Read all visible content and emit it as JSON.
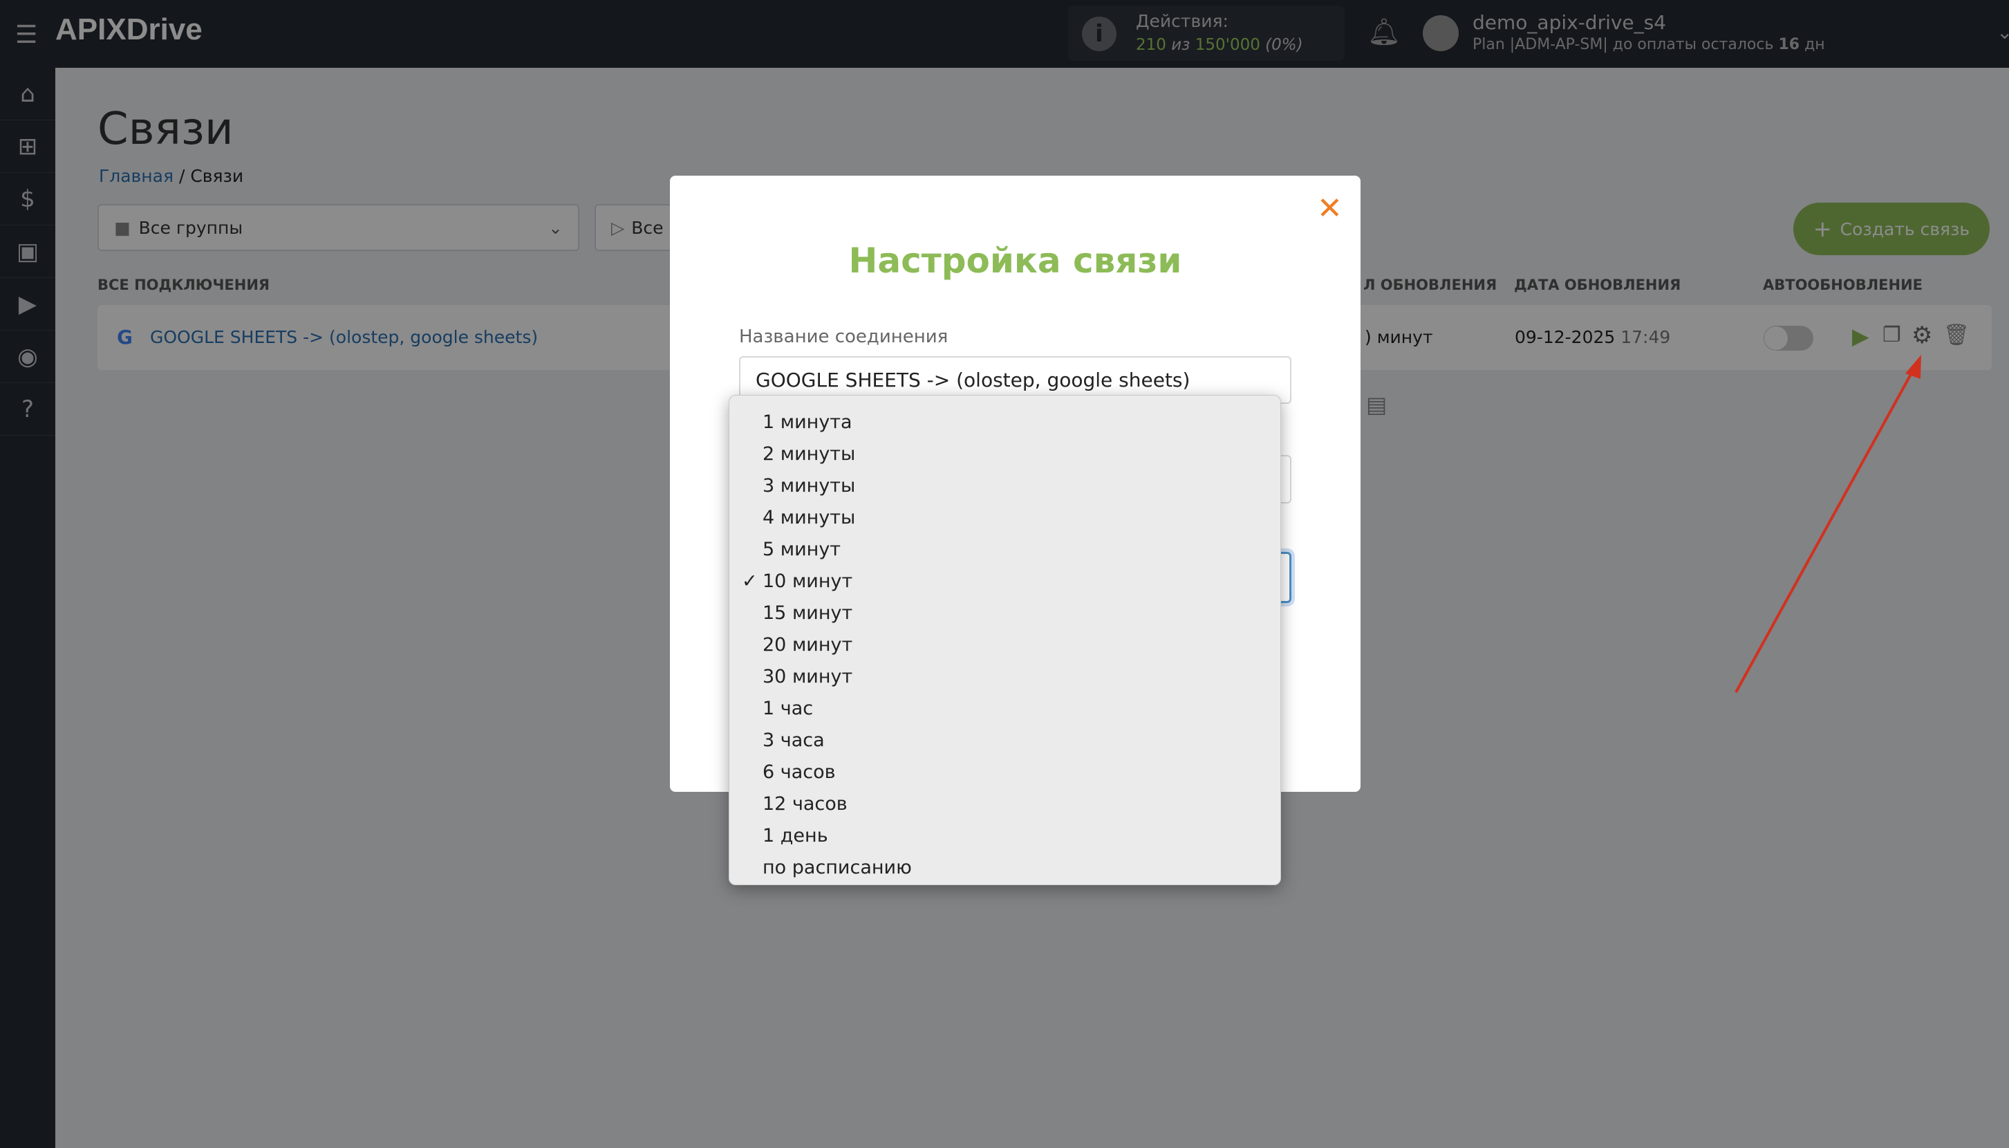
{
  "header": {
    "logo": "APIXDrive",
    "actions_label": "Действия:",
    "actions_used": "210",
    "actions_sep": "из",
    "actions_total": "150'000",
    "actions_pct": "(0%)",
    "username": "demo_apix-drive_s4",
    "plan_prefix": "Plan |ADM-AP-SM| до оплаты осталось",
    "plan_days": "16",
    "plan_suffix": "дн"
  },
  "page": {
    "title": "Связи",
    "breadcrumb_home": "Главная",
    "breadcrumb_sep": "/",
    "breadcrumb_current": "Связи",
    "group_select": "Все группы",
    "status_select": "Все",
    "create_button": "Создать связь"
  },
  "table": {
    "col_all": "ВСЕ ПОДКЛЮЧЕНИЯ",
    "col_interval": "Л ОБНОВЛЕНИЯ",
    "col_date": "ДАТА ОБНОВЛЕНИЯ",
    "col_auto": "АВТООБНОВЛЕНИЕ",
    "row": {
      "name": "GOOGLE SHEETS -> (olostep, google sheets)",
      "interval": ") минут",
      "date": "09-12-2025",
      "time": "17:49",
      "autoupdate": false
    }
  },
  "modal": {
    "title": "Настройка связи",
    "name_label": "Название соединения",
    "name_value": "GOOGLE SHEETS -> (olostep, google sheets)"
  },
  "dropdown": {
    "selected": "10 минут",
    "options": [
      "1 минута",
      "2 минуты",
      "3 минуты",
      "4 минуты",
      "5 минут",
      "10 минут",
      "15 минут",
      "20 минут",
      "30 минут",
      "1 час",
      "3 часа",
      "6 часов",
      "12 часов",
      "1 день",
      "по расписанию"
    ]
  },
  "colors": {
    "accent": "#8dbb57",
    "close": "#f07d22",
    "link": "#2a6fb0",
    "arrow": "#d0321f"
  }
}
